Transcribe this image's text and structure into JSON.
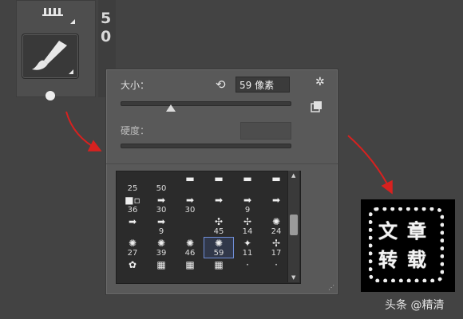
{
  "toolbar": {
    "side_digits": [
      "5",
      "0"
    ],
    "brush_tool_icon": "brush-icon"
  },
  "brush_panel": {
    "size_label": "大小：",
    "size_value": "59 像素",
    "hardness_label": "硬度：",
    "reset_icon": "reset-icon",
    "settings_icon": "gear-icon",
    "new_preset_icon": "new-preset-icon",
    "presets": [
      {
        "label": "25",
        "glyph": ""
      },
      {
        "label": "50",
        "glyph": ""
      },
      {
        "label": "",
        "glyph": "▬"
      },
      {
        "label": "",
        "glyph": "▬"
      },
      {
        "label": "",
        "glyph": "▬"
      },
      {
        "label": "",
        "glyph": "▬"
      },
      {
        "label": "36",
        "glyph": "■▫"
      },
      {
        "label": "30",
        "glyph": "➡"
      },
      {
        "label": "30",
        "glyph": "➡"
      },
      {
        "label": "",
        "glyph": "➡"
      },
      {
        "label": "9",
        "glyph": "➡"
      },
      {
        "label": "",
        "glyph": "➡"
      },
      {
        "label": "",
        "glyph": "➡"
      },
      {
        "label": "9",
        "glyph": "➡"
      },
      {
        "label": "",
        "glyph": ""
      },
      {
        "label": "45",
        "glyph": "✣"
      },
      {
        "label": "14",
        "glyph": "✢"
      },
      {
        "label": "24",
        "glyph": "✺"
      },
      {
        "label": "27",
        "glyph": "✺"
      },
      {
        "label": "39",
        "glyph": "✺"
      },
      {
        "label": "46",
        "glyph": "✺"
      },
      {
        "label": "59",
        "glyph": "✺",
        "selected": true
      },
      {
        "label": "11",
        "glyph": "✦"
      },
      {
        "label": "17",
        "glyph": "✢"
      },
      {
        "label": "",
        "glyph": "✿"
      },
      {
        "label": "",
        "glyph": "▦"
      },
      {
        "label": "",
        "glyph": "▦"
      },
      {
        "label": "",
        "glyph": "▦"
      },
      {
        "label": "",
        "glyph": "·"
      },
      {
        "label": "",
        "glyph": "·"
      }
    ],
    "selected_size": 59
  },
  "result_stamp": {
    "characters": [
      "文",
      "章",
      "转",
      "载"
    ]
  },
  "watermark": "头条 @精清",
  "colors": {
    "arrow": "#d8211f",
    "selection": "#6f8fd8",
    "background": "#434343"
  }
}
